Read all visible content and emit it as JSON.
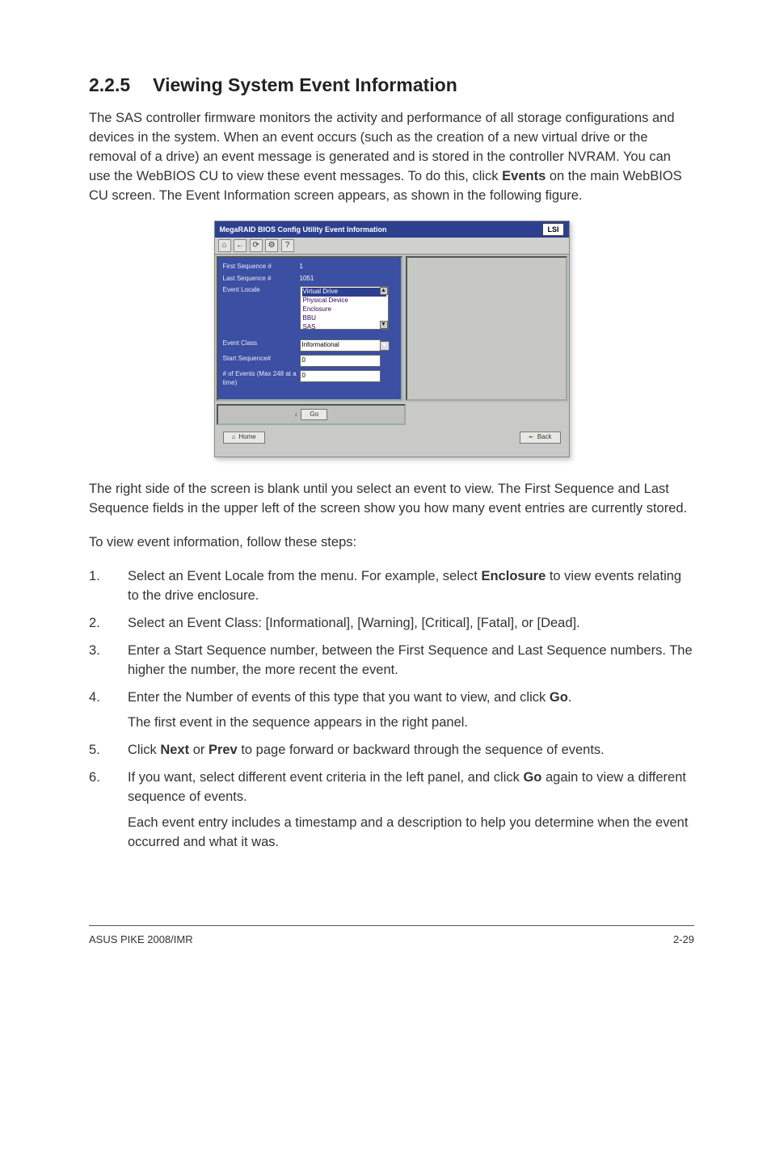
{
  "heading": {
    "number": "2.2.5",
    "title": "Viewing System Event Information"
  },
  "intro": {
    "p1a": "The SAS controller firmware monitors the activity and performance of all storage configurations and devices in the system. When an event occurs (such as the creation of a new virtual drive or the removal of a drive) an event message is generated and is stored in the controller NVRAM. You can use the WebBIOS CU to view these event messages. To do this, click ",
    "p1b": "Events",
    "p1c": " on the main WebBIOS CU screen. The Event Information screen appears, as shown in the following figure."
  },
  "screenshot": {
    "title": "MegaRAID BIOS Config Utility Event Information",
    "logo": "LSI",
    "toolbar": [
      "⌂",
      "←",
      "⟳",
      "⚙",
      "?"
    ],
    "labels": {
      "first_seq": "First Sequence #",
      "last_seq": "Last Sequence #",
      "event_locale": "Event Locale",
      "event_class": "Event Class",
      "start_seq": "Start Sequence#",
      "num_events": "# of Events (Max 248 at a time)"
    },
    "values": {
      "first_seq": "1",
      "last_seq": "1051",
      "locale_opts": [
        "Virtual Drive",
        "Physical Device",
        "Enclosure",
        "BBU",
        "SAS"
      ],
      "event_class": "Informational",
      "start_seq": "0",
      "num_events": "0"
    },
    "buttons": {
      "go": "Go",
      "home": "Home",
      "back": "Back"
    }
  },
  "after": {
    "p2": "The right side of the screen is blank until you select an event to view. The First Sequence and Last Sequence fields in the upper left of the screen show you how many event entries are currently stored.",
    "p3": "To view event information, follow these steps:"
  },
  "steps": {
    "s1a": "Select an Event Locale from the menu. For example, select ",
    "s1b": "Enclosure",
    "s1c": " to view events relating to the drive enclosure.",
    "s2": "Select an Event Class: [Informational], [Warning], [Critical], [Fatal], or [Dead].",
    "s3": "Enter a Start Sequence number, between the First Sequence and Last Sequence numbers. The higher the number, the more recent the event.",
    "s4a": "Enter the Number of events of this type that you want to view, and click ",
    "s4b": "Go",
    "s4c": ".",
    "s4d": "The first event in the sequence appears in the right panel.",
    "s5a": "Click ",
    "s5b": "Next",
    "s5c": " or ",
    "s5d": "Prev",
    "s5e": " to page forward or backward through the sequence of events.",
    "s6a": "If you want, select different event criteria in the left panel, and click ",
    "s6b": "Go",
    "s6c": " again to view a different sequence of events.",
    "s6d": "Each event entry includes a timestamp and a description to help you determine when the event occurred and what it was."
  },
  "footer": {
    "left": "ASUS PIKE 2008/IMR",
    "right": "2-29"
  }
}
